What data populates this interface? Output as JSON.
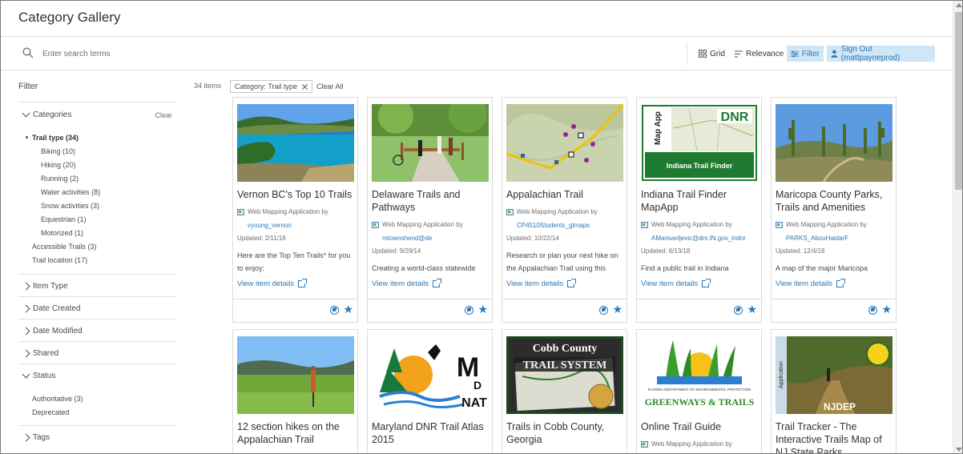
{
  "header": {
    "title": "Category Gallery"
  },
  "search": {
    "placeholder": "Enter search terms"
  },
  "toolbar": {
    "grid_label": "Grid",
    "relevance_label": "Relevance",
    "filter_label": "Filter",
    "signout_label": "Sign Out (mattpayneprod)",
    "active_color": "#cfe6f6"
  },
  "sidebar": {
    "title": "Filter",
    "categories": {
      "label": "Categories",
      "clear": "Clear",
      "items": [
        {
          "label": "Trail type (34)",
          "level": 0,
          "selected": true
        },
        {
          "label": "Biking (10)",
          "level": 1
        },
        {
          "label": "Hiking (20)",
          "level": 1
        },
        {
          "label": "Running (2)",
          "level": 1
        },
        {
          "label": "Water activities (8)",
          "level": 1
        },
        {
          "label": "Snow activities (3)",
          "level": 1
        },
        {
          "label": "Equestrian (1)",
          "level": 1
        },
        {
          "label": "Motorized (1)",
          "level": 1
        },
        {
          "label": "Accessible Trails (3)",
          "level": 0
        },
        {
          "label": "Trail location (17)",
          "level": 0
        }
      ]
    },
    "item_type": "Item Type",
    "date_created": "Date Created",
    "date_modified": "Date Modified",
    "shared": "Shared",
    "status": {
      "label": "Status",
      "items": [
        "Authoritative (3)",
        "Deprecated"
      ]
    },
    "tags": "Tags"
  },
  "results": {
    "count": "34 items",
    "chip": "Category: Trail type",
    "clear_all": "Clear All"
  },
  "cards": [
    {
      "title": "Vernon BC's Top 10 Trails",
      "type": "Web Mapping Application by",
      "owner": "vyoung_vernon",
      "updated": "Updated: 2/11/16",
      "snippet": "Here are the Top Ten Trails* for you to enjoy:",
      "details": "View item details",
      "thumb": "lake"
    },
    {
      "title": "Delaware Trails and Pathways",
      "type": "Web Mapping Application by",
      "owner": "mtownshend@de",
      "updated": "Updated: 9/29/14",
      "snippet": "Creating a world-class statewide",
      "details": "View item details",
      "thumb": "path"
    },
    {
      "title": "Appalachian Trail",
      "type": "Web Mapping Application by",
      "owner": "CP4510Students_gtmaps",
      "updated": "Updated: 10/22/14",
      "snippet": "Research or plan your next hike on the Appalachian Trail using this",
      "details": "View item details",
      "thumb": "map"
    },
    {
      "title": "Indiana Trail Finder MapApp",
      "type": "Web Mapping Application by",
      "owner": "AMarisavljevic@dnr.IN.gov_indnr",
      "updated": "Updated: 6/13/18",
      "snippet": "Find a public trail in Indiana",
      "details": "View item details",
      "thumb": "dnr",
      "thumb_text": {
        "side": "Map App",
        "logo": "DNR",
        "banner": "Indiana Trail Finder"
      }
    },
    {
      "title": "Maricopa County Parks, Trails and Amenities",
      "type": "Web Mapping Application by",
      "owner": "PARKS_AbouHaidarF",
      "updated": "Updated: 12/4/18",
      "snippet": "A map of the major Maricopa",
      "details": "View item details",
      "thumb": "desert"
    },
    {
      "title": "12 section hikes on the Appalachian Trail",
      "thumb": "meadow"
    },
    {
      "title": "Maryland DNR Trail Atlas 2015",
      "thumb": "mdnr",
      "thumb_text": {
        "line1": "M",
        "line2": "D",
        "line3": "NAT"
      }
    },
    {
      "title": "Trails in Cobb County, Georgia",
      "thumb": "cobb",
      "thumb_text": {
        "line1": "Cobb County",
        "line2": "TRAIL SYSTEM"
      }
    },
    {
      "title": "Online Trail Guide",
      "type": "Web Mapping Application by",
      "thumb": "greenways",
      "thumb_text": {
        "small": "FLORIDA DEPARTMENT OF ENVIRONMENTAL PROTECTION",
        "big": "GREENWAYS & TRAILS"
      }
    },
    {
      "title": "Trail Tracker - The Interactive Trails Map of NJ State Parks",
      "thumb": "nj",
      "thumb_text": {
        "side": "Application",
        "logo": "NJDEP"
      }
    }
  ],
  "colors": {
    "link": "#2979b8",
    "text": "#323232",
    "muted": "#6e6e6e",
    "border": "#dcdcdc"
  }
}
